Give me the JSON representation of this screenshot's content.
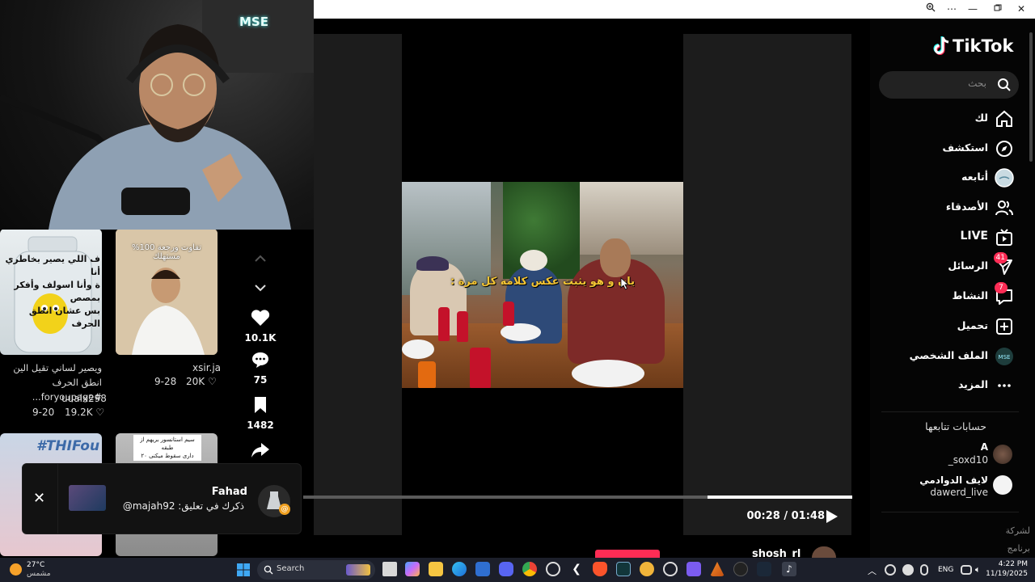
{
  "webcam": {
    "overlay_logo": "MSE"
  },
  "feed": {
    "thumbnails": [
      {
        "overlay_lines": [
          "ف اللي يصير بخاطري أنا",
          "ة وأنا اسولف وأفكر بمصص",
          "بس عشان انطق الحرف"
        ],
        "caption": "ويصير لساني تقيل الين انطق الحرف #foryoupage...",
        "author": "uualx298",
        "date": "9-20",
        "likes": "19.2K"
      },
      {
        "overlay_lines": [
          "%100 تفاوت ورجعة مستهلك"
        ],
        "caption": "",
        "author": "xsir.ja",
        "date": "9-28",
        "likes": "20K"
      },
      {
        "overlay_lines": [
          "#THIFou"
        ],
        "caption": "",
        "author": "",
        "date": "",
        "likes": ""
      },
      {
        "overlay_lines": [
          "سيم استانسور بريهم از طبقه",
          "۲۰ داری سقوط میکنی"
        ],
        "caption": "",
        "author": "",
        "date": "",
        "likes": ""
      }
    ]
  },
  "actions": {
    "likes": "10.1K",
    "comments": "75",
    "saves": "1482"
  },
  "video": {
    "caption": "يان و هو يثبت عكس كلامه كل مرة :",
    "time": "00:28 / 01:48",
    "progress_fraction": 0.263
  },
  "notification": {
    "name": "Fahad",
    "text": "ذكرك في تعليق: majah92@"
  },
  "peek": {
    "username": "shosh_rl"
  },
  "sidebar": {
    "brand": "TikTok",
    "search_placeholder": "بحث",
    "nav": [
      {
        "label": "لك",
        "icon": "home-icon"
      },
      {
        "label": "استكشف",
        "icon": "compass-icon"
      },
      {
        "label": "أتابعه",
        "icon": "following-avatar-icon"
      },
      {
        "label": "الأصدقاء",
        "icon": "friends-icon"
      },
      {
        "label": "LIVE",
        "icon": "live-tv-icon"
      },
      {
        "label": "الرسائل",
        "icon": "messages-icon",
        "badge": "41"
      },
      {
        "label": "النشاط",
        "icon": "activity-icon",
        "badge": "7"
      },
      {
        "label": "تحميل",
        "icon": "upload-icon"
      },
      {
        "label": "الملف الشخصي",
        "icon": "profile-avatar-icon"
      },
      {
        "label": "المزيد",
        "icon": "more-icon"
      }
    ],
    "following_title": "حسابات تتابعها",
    "accounts": [
      {
        "name": "A",
        "handle": "_soxd10"
      },
      {
        "name": "لايف الدوادمي",
        "handle": "dawerd_live"
      }
    ],
    "footer_lines": [
      "لشركة",
      "برنامج"
    ]
  },
  "taskbar": {
    "weather_temp": "27°C",
    "weather_desc": "مشمس",
    "search_label": "Search",
    "lang": "ENG",
    "time": "4:22 PM",
    "date": "11/19/2025"
  }
}
